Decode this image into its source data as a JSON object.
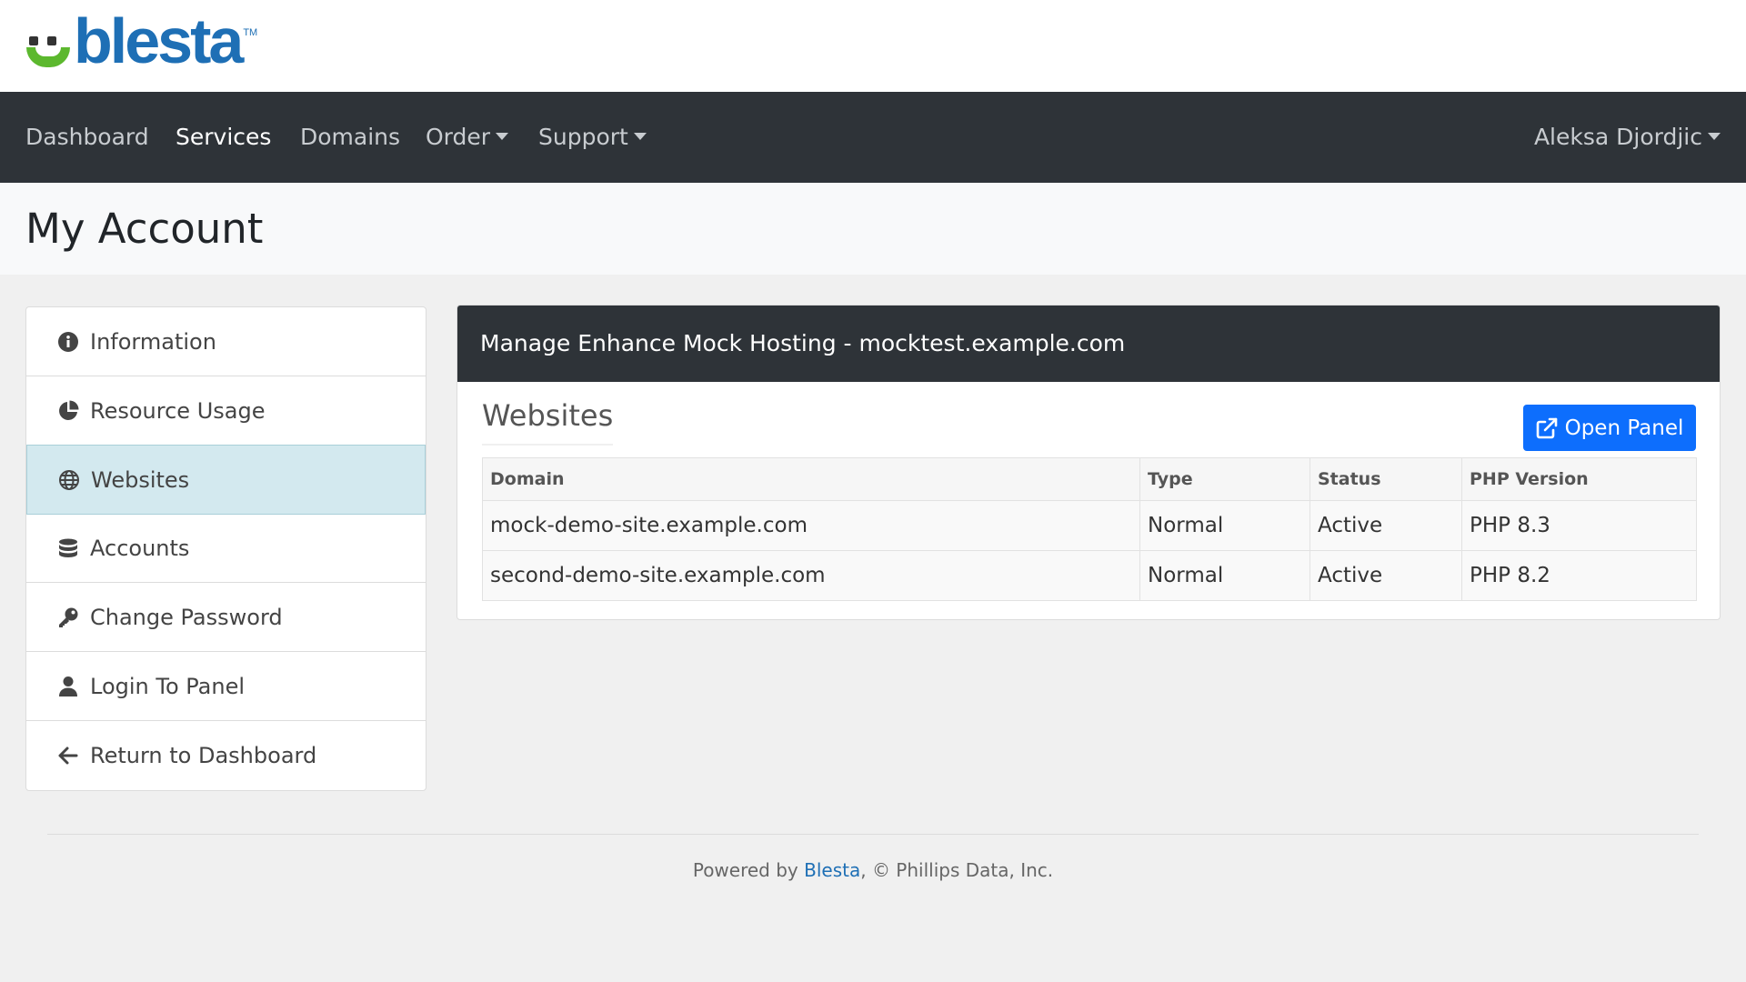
{
  "brand": {
    "name": "blesta",
    "tm": "TM"
  },
  "nav": {
    "items": [
      {
        "label": "Dashboard"
      },
      {
        "label": "Services"
      },
      {
        "label": "Domains"
      },
      {
        "label": "Order"
      },
      {
        "label": "Support"
      }
    ],
    "user": "Aleksa Djordjic"
  },
  "page": {
    "title": "My Account"
  },
  "sidebar": {
    "items": [
      {
        "label": "Information",
        "icon": "info-circle-icon"
      },
      {
        "label": "Resource Usage",
        "icon": "pie-chart-icon"
      },
      {
        "label": "Websites",
        "icon": "globe-icon"
      },
      {
        "label": "Accounts",
        "icon": "database-icon"
      },
      {
        "label": "Change Password",
        "icon": "key-icon"
      },
      {
        "label": "Login To Panel",
        "icon": "user-icon"
      },
      {
        "label": "Return to Dashboard",
        "icon": "arrow-left-icon"
      }
    ],
    "active_label": "Websites"
  },
  "panel": {
    "heading": "Manage Enhance Mock Hosting - mocktest.example.com",
    "section_title": "Websites",
    "open_panel_label": "Open Panel",
    "table": {
      "headers": [
        "Domain",
        "Type",
        "Status",
        "PHP Version"
      ],
      "rows": [
        [
          "mock-demo-site.example.com",
          "Normal",
          "Active",
          "PHP 8.3"
        ],
        [
          "second-demo-site.example.com",
          "Normal",
          "Active",
          "PHP 8.2"
        ]
      ]
    }
  },
  "footer": {
    "prefix": "Powered by ",
    "link": "Blesta",
    "suffix": ", © Phillips Data, Inc."
  },
  "colors": {
    "navbar": "#2e3338",
    "accent_blue": "#0d6efd",
    "brand_blue": "#1e6fb5",
    "brand_green": "#5cb82e",
    "active_item": "#d3e9ef"
  }
}
